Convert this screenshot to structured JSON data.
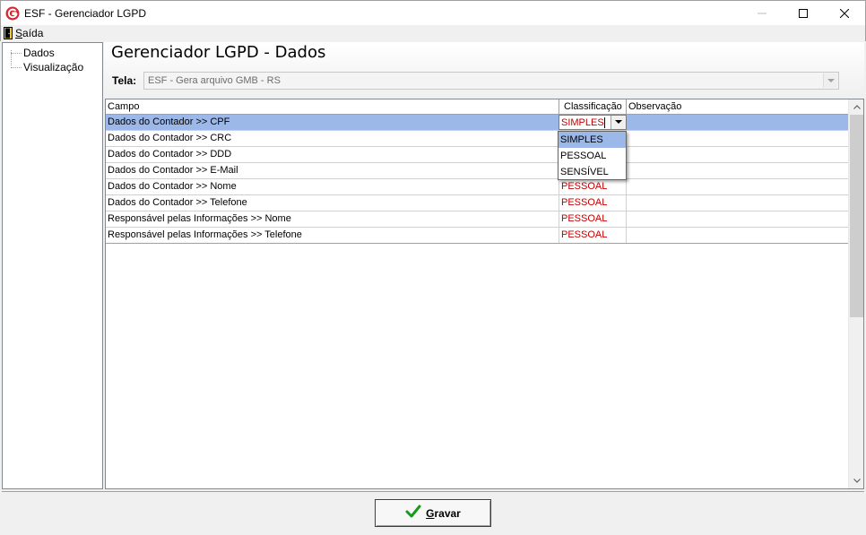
{
  "window": {
    "title": "ESF - Gerenciador LGPD",
    "icon": "esf-logo-icon",
    "controls": [
      "minimize-icon",
      "maximize-icon",
      "close-icon"
    ]
  },
  "menu": {
    "items": [
      {
        "label": "Saída",
        "mnemonic": "S",
        "rest": "aída",
        "icon": "exit-door-icon"
      }
    ]
  },
  "tree": {
    "items": [
      {
        "label": "Dados"
      },
      {
        "label": "Visualização"
      }
    ]
  },
  "main": {
    "title": "Gerenciador LGPD - Dados",
    "screen": {
      "label": "Tela:",
      "value": "ESF - Gera arquivo GMB - RS"
    }
  },
  "table": {
    "columns": [
      "Campo",
      "Classificação",
      "Observação"
    ],
    "rows": [
      {
        "campo": "Dados do Contador >> CPF",
        "classificacao": "SIMPLES",
        "observacao": ""
      },
      {
        "campo": "Dados do Contador >> CRC",
        "classificacao": "",
        "observacao": ""
      },
      {
        "campo": "Dados do Contador >> DDD",
        "classificacao": "",
        "observacao": ""
      },
      {
        "campo": "Dados do Contador >> E-Mail",
        "classificacao": "",
        "observacao": ""
      },
      {
        "campo": "Dados do Contador >> Nome",
        "classificacao": "PESSOAL",
        "observacao": ""
      },
      {
        "campo": "Dados do Contador >> Telefone",
        "classificacao": "PESSOAL",
        "observacao": ""
      },
      {
        "campo": "Responsável pelas Informações >> Nome",
        "classificacao": "PESSOAL",
        "observacao": ""
      },
      {
        "campo": "Responsável pelas Informações >> Telefone",
        "classificacao": "PESSOAL",
        "observacao": ""
      }
    ],
    "selected_row": 0,
    "editor": {
      "value": "SIMPLES",
      "options": [
        "SIMPLES",
        "PESSOAL",
        "SENSÍVEL"
      ],
      "highlighted": "SIMPLES"
    }
  },
  "footer": {
    "save_button": {
      "mnemonic": "G",
      "rest": "ravar",
      "icon": "checkmark-icon"
    }
  },
  "colors": {
    "selection": "#9cb8e8",
    "classification_text": "#c00000",
    "check": "#1a9a1a"
  }
}
